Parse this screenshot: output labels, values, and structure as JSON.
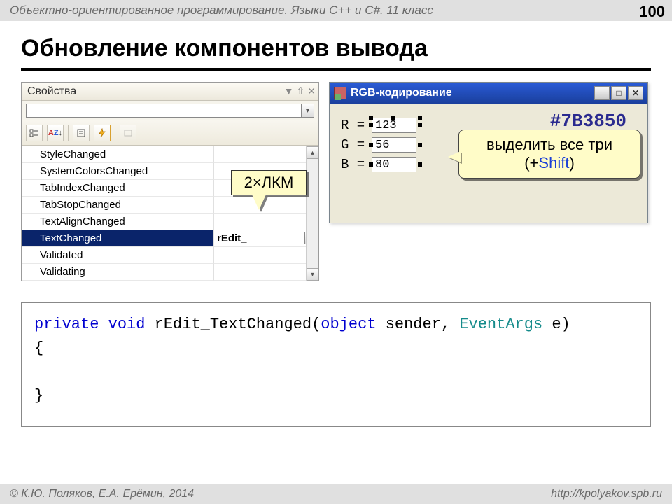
{
  "header": {
    "breadcrumb": "Объектно-ориентированное программирование. Языки C++ и C#. 11 класс"
  },
  "page_number": "100",
  "title": "Обновление компонентов вывода",
  "properties_panel": {
    "title": "Свойства",
    "events": [
      "StyleChanged",
      "SystemColorsChanged",
      "TabIndexChanged",
      "TabStopChanged",
      "TextAlignChanged",
      "TextChanged",
      "Validated",
      "Validating"
    ],
    "selected_index": 5,
    "selected_value": "rEdit_"
  },
  "rgb_window": {
    "title": "RGB-кодирование",
    "fields": [
      {
        "label": "R =",
        "value": "123"
      },
      {
        "label": "G =",
        "value": "56"
      },
      {
        "label": "B =",
        "value": "80"
      }
    ],
    "hex": "#7B3850"
  },
  "callouts": {
    "dblclick": "2×ЛКМ",
    "select_all_line1": "выделить все три",
    "select_all_line2_prefix": "(+",
    "select_all_shift": "Shift",
    "select_all_line2_suffix": ")"
  },
  "code": {
    "kw_private": "private",
    "kw_void": "void",
    "method": " rEdit_TextChanged(",
    "kw_object": "object",
    "arg1": " sender, ",
    "tp_eventargs": "EventArgs",
    "arg2": " e)",
    "brace_open": "{",
    "brace_close": "}"
  },
  "footer": {
    "left": "© К.Ю. Поляков, Е.А. Ерёмин, 2014",
    "right": "http://kpolyakov.spb.ru"
  }
}
